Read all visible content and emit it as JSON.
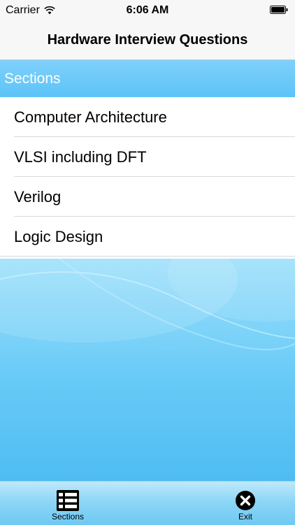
{
  "status_bar": {
    "carrier": "Carrier",
    "time": "6:06 AM",
    "wifi_icon": "wifi-icon",
    "battery_icon": "battery-icon"
  },
  "nav": {
    "title": "Hardware Interview Questions"
  },
  "section_header": {
    "label": "Sections",
    "color": "#6cc9f8"
  },
  "sections": [
    {
      "label": "Computer Architecture"
    },
    {
      "label": "VLSI including DFT"
    },
    {
      "label": "Verilog"
    },
    {
      "label": "Logic Design"
    }
  ],
  "tab_bar": {
    "sections": {
      "label": "Sections",
      "icon": "list-icon"
    },
    "exit": {
      "label": "Exit",
      "icon": "close-circle-icon"
    }
  }
}
